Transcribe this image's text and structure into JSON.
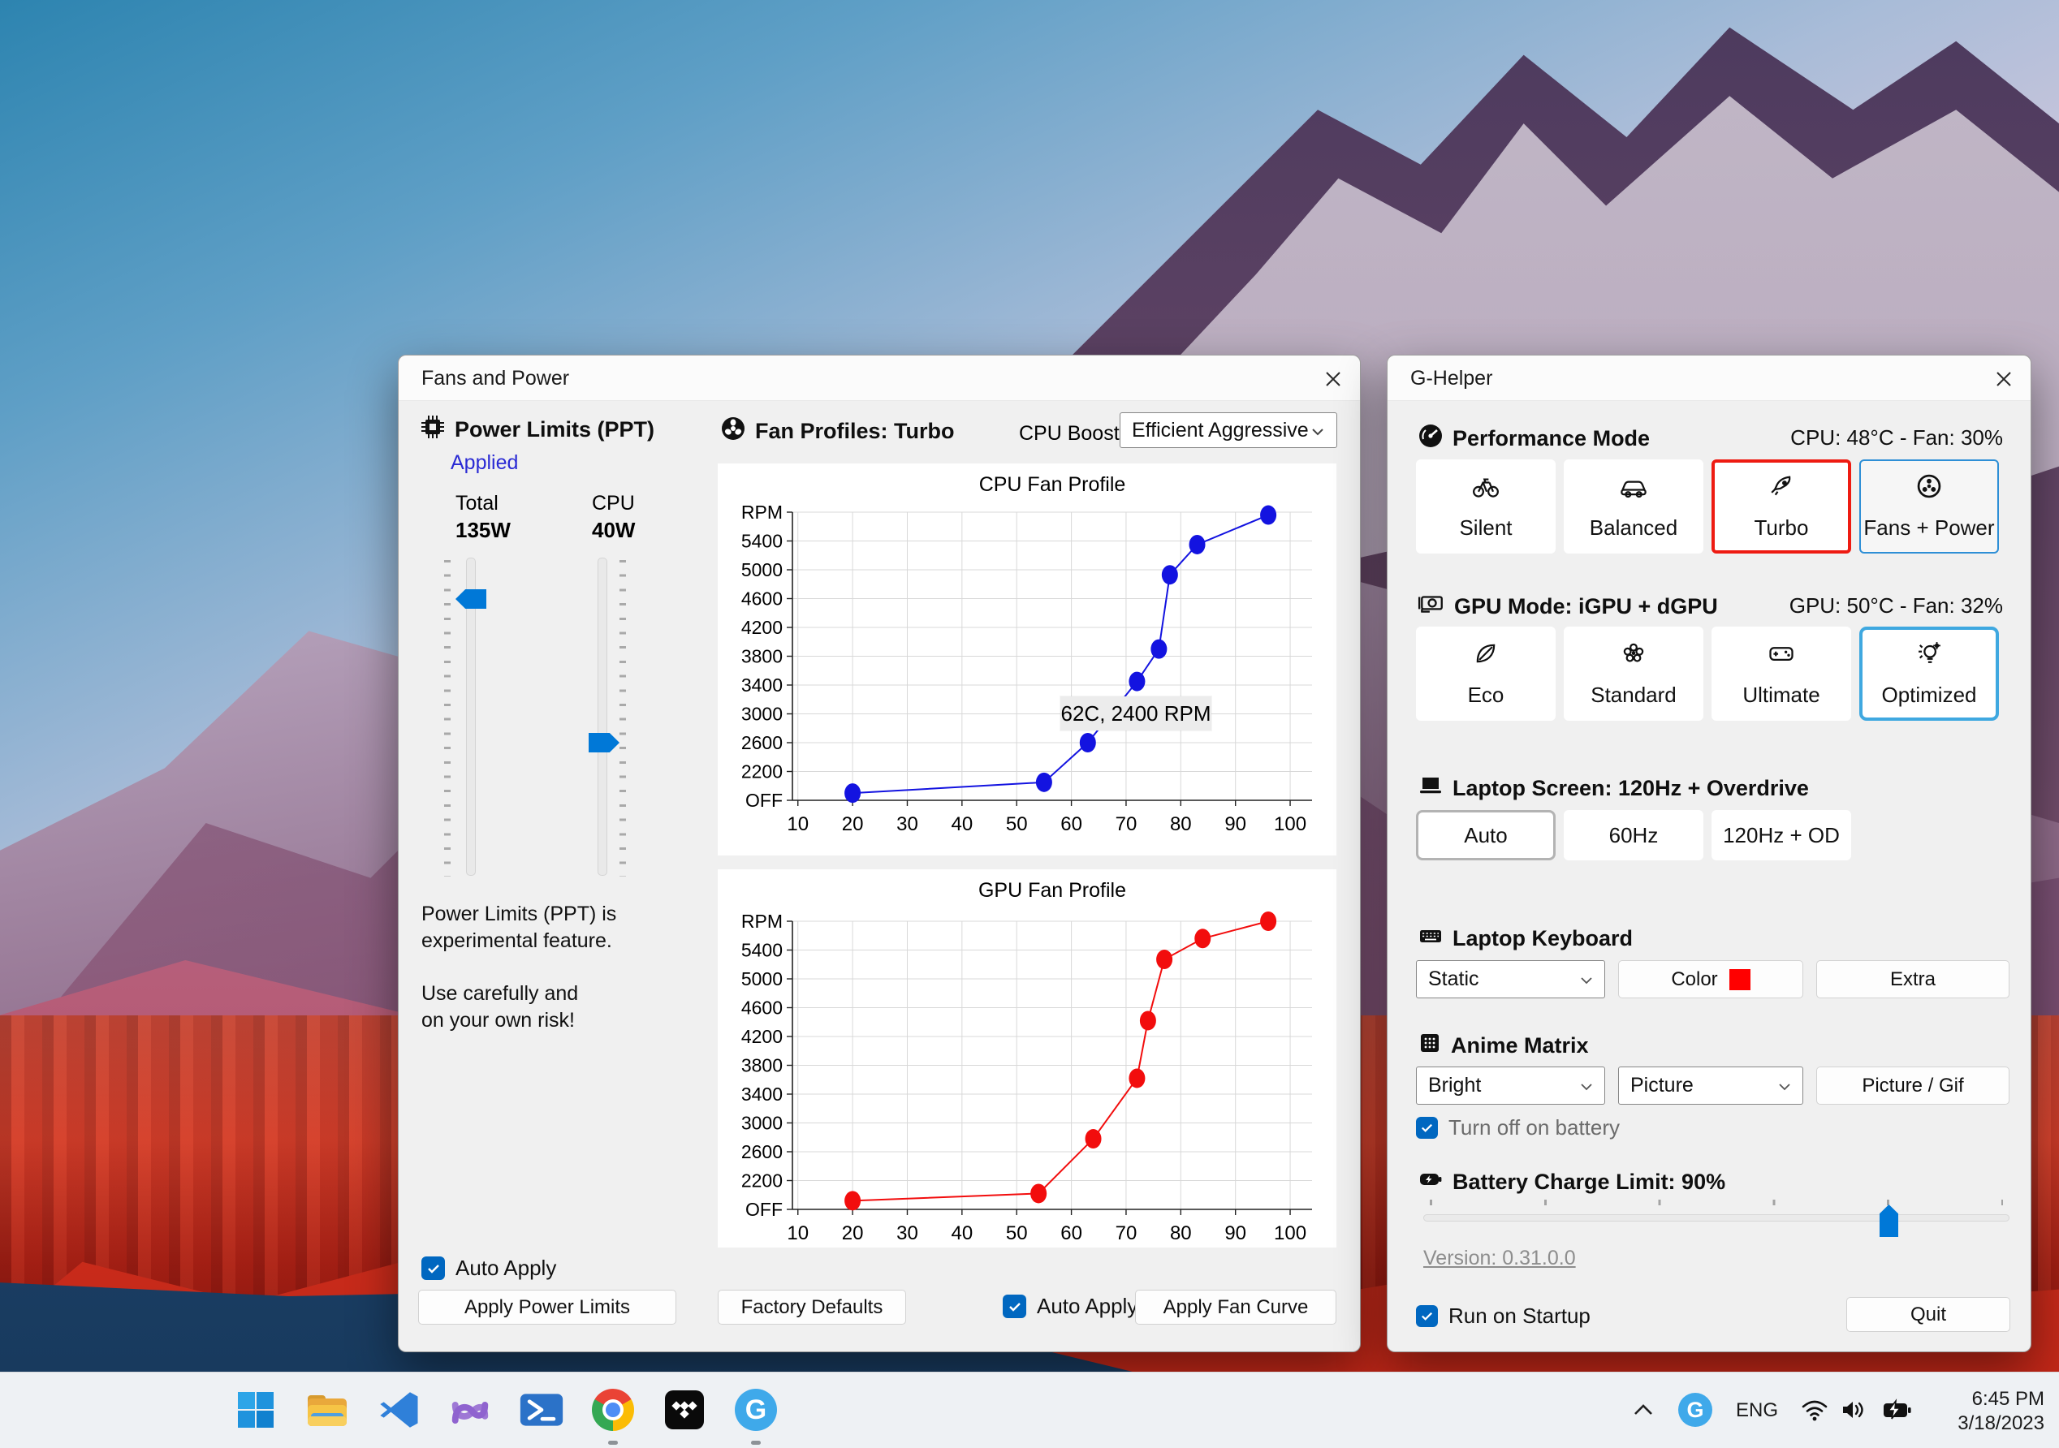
{
  "fans_power_window": {
    "title": "Fans and Power",
    "power_limits": {
      "heading": "Power Limits (PPT)",
      "status": "Applied",
      "total_label": "Total",
      "total_value": "135W",
      "cpu_label": "CPU",
      "cpu_value": "40W",
      "note1_line1": "Power Limits (PPT) is",
      "note1_line2": "experimental feature.",
      "note2_line1": "Use carefully and",
      "note2_line2": "on your own risk!",
      "auto_apply_label": "Auto Apply",
      "apply_button": "Apply Power Limits"
    },
    "fan_profiles": {
      "heading": "Fan Profiles: Turbo",
      "cpu_boost_label": "CPU Boost",
      "cpu_boost_value": "Efficient Aggressive",
      "factory_defaults_button": "Factory Defaults",
      "auto_apply_label": "Auto Apply",
      "apply_button": "Apply Fan Curve"
    }
  },
  "ghelper_window": {
    "title": "G-Helper",
    "performance": {
      "heading": "Performance Mode",
      "stats": "CPU: 48°C -  Fan: 30%",
      "buttons": [
        {
          "label": "Silent",
          "icon": "bicycle-icon"
        },
        {
          "label": "Balanced",
          "icon": "car-icon"
        },
        {
          "label": "Turbo",
          "icon": "rocket-icon"
        },
        {
          "label": "Fans + Power",
          "icon": "fan-icon"
        }
      ]
    },
    "gpu": {
      "heading": "GPU Mode: iGPU + dGPU",
      "stats": "GPU: 50°C -  Fan: 32%",
      "buttons": [
        {
          "label": "Eco",
          "icon": "leaf-icon"
        },
        {
          "label": "Standard",
          "icon": "flower-icon"
        },
        {
          "label": "Ultimate",
          "icon": "gamepad-icon"
        },
        {
          "label": "Optimized",
          "icon": "bulb-gear-icon"
        }
      ]
    },
    "screen": {
      "heading": "Laptop Screen: 120Hz + Overdrive",
      "buttons": [
        {
          "label": "Auto"
        },
        {
          "label": "60Hz"
        },
        {
          "label": "120Hz + OD"
        }
      ]
    },
    "keyboard": {
      "heading": "Laptop Keyboard",
      "mode_value": "Static",
      "color_button": "Color",
      "swatch_color": "#ff0000",
      "extra_button": "Extra"
    },
    "matrix": {
      "heading": "Anime Matrix",
      "brightness_value": "Bright",
      "content_value": "Picture",
      "picture_button": "Picture / Gif",
      "battery_checkbox_label": "Turn off on battery"
    },
    "battery": {
      "heading": "Battery Charge Limit: 90%"
    },
    "version_link": "Version: 0.31.0.0",
    "run_on_startup_label": "Run on Startup",
    "quit_button": "Quit"
  },
  "taskbar": {
    "tray": {
      "language": "ENG",
      "time": "6:45 PM",
      "date": "3/18/2023",
      "ghelper_badge": "G"
    },
    "ghelper_icon_letter": "G"
  },
  "chart_data": [
    {
      "type": "line",
      "title": "CPU Fan Profile",
      "color": "#1313e0",
      "x": [
        20,
        55,
        63,
        72,
        76,
        78,
        83,
        96
      ],
      "y": [
        1900,
        2050,
        2600,
        3450,
        3900,
        4930,
        5350,
        5760
      ],
      "xticks": [
        10,
        20,
        30,
        40,
        50,
        60,
        70,
        80,
        90,
        100
      ],
      "ytick_values": [
        1800,
        2200,
        2600,
        3000,
        3400,
        3800,
        4200,
        4600,
        5000,
        5400,
        5800
      ],
      "ytick_labels": [
        "OFF",
        "2200",
        "2600",
        "3000",
        "3400",
        "3800",
        "4200",
        "4600",
        "5000",
        "5400",
        "RPM"
      ],
      "xlim": [
        9,
        104
      ],
      "ylim": [
        1800,
        5800
      ],
      "grid": true,
      "legend": "none",
      "tooltip": "62C, 2400 RPM"
    },
    {
      "type": "line",
      "title": "GPU Fan Profile",
      "color": "#f20d0d",
      "x": [
        20,
        54,
        64,
        72,
        74,
        77,
        84,
        96
      ],
      "y": [
        1920,
        2020,
        2780,
        3620,
        4420,
        5270,
        5560,
        5800
      ],
      "xticks": [
        10,
        20,
        30,
        40,
        50,
        60,
        70,
        80,
        90,
        100
      ],
      "ytick_values": [
        1800,
        2200,
        2600,
        3000,
        3400,
        3800,
        4200,
        4600,
        5000,
        5400,
        5800
      ],
      "ytick_labels": [
        "OFF",
        "2200",
        "2600",
        "3000",
        "3400",
        "3800",
        "4200",
        "4600",
        "5000",
        "5400",
        "RPM"
      ],
      "xlim": [
        9,
        104
      ],
      "ylim": [
        1800,
        5800
      ],
      "grid": true,
      "legend": "none"
    }
  ]
}
